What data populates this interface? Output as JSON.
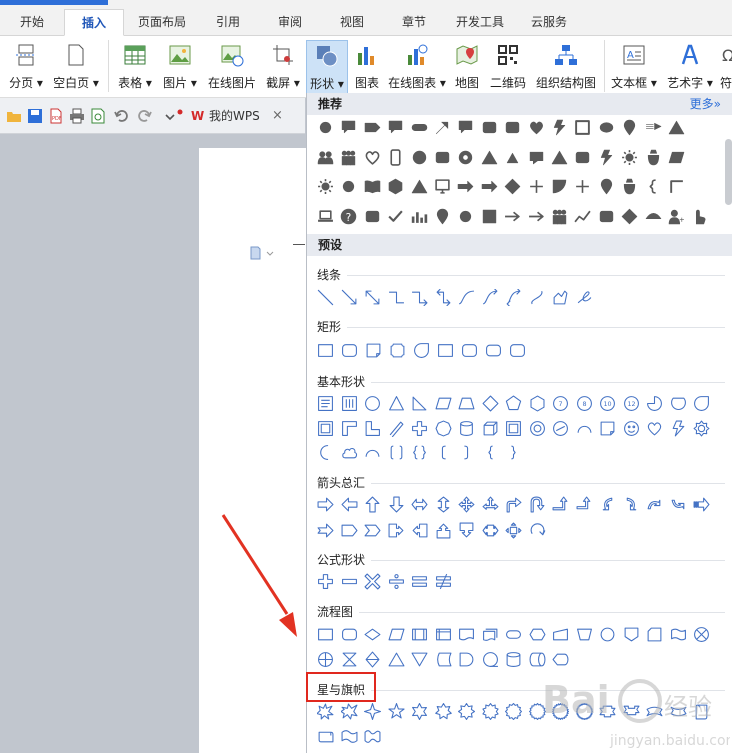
{
  "menu_tabs": [
    "开始",
    "插入",
    "页面布局",
    "引用",
    "审阅",
    "视图",
    "章节",
    "开发工具",
    "云服务"
  ],
  "active_tab": "插入",
  "ribbon_tools": [
    {
      "label": "分页 ▾",
      "icon": "page-break-icon"
    },
    {
      "label": "空白页 ▾",
      "icon": "blank-page-icon"
    },
    {
      "label": "表格 ▾",
      "icon": "table-icon"
    },
    {
      "label": "图片 ▾",
      "icon": "picture-icon"
    },
    {
      "label": "在线图片",
      "icon": "online-picture-icon"
    },
    {
      "label": "截屏 ▾",
      "icon": "screenshot-icon"
    },
    {
      "label": "形状 ▾",
      "icon": "shapes-icon"
    },
    {
      "label": "图表",
      "icon": "chart-icon"
    },
    {
      "label": "在线图表 ▾",
      "icon": "online-chart-icon"
    },
    {
      "label": "地图",
      "icon": "map-icon"
    },
    {
      "label": "二维码",
      "icon": "qrcode-icon"
    },
    {
      "label": "组织结构图",
      "icon": "org-chart-icon"
    },
    {
      "label": "文本框 ▾",
      "icon": "textbox-icon"
    },
    {
      "label": "艺术字 ▾",
      "icon": "wordart-icon"
    },
    {
      "label": "符",
      "icon": "symbol-icon"
    }
  ],
  "document_tab": {
    "label": "我的WPS",
    "close": "×"
  },
  "panel": {
    "recommended_header": "推荐",
    "more_link": "更多»",
    "preset_header": "预设",
    "sections": [
      "线条",
      "矩形",
      "基本形状",
      "箭头总汇",
      "公式形状",
      "流程图",
      "星与旗帜"
    ]
  },
  "highlighted_section": "星与旗帜",
  "watermark_text": "Bai经验 jingyan.baidu.com",
  "colors": {
    "accent": "#2e6fd8",
    "shape_outline": "#4472c4",
    "highlight": "#e0281e",
    "recommended_fill": "#595959"
  }
}
